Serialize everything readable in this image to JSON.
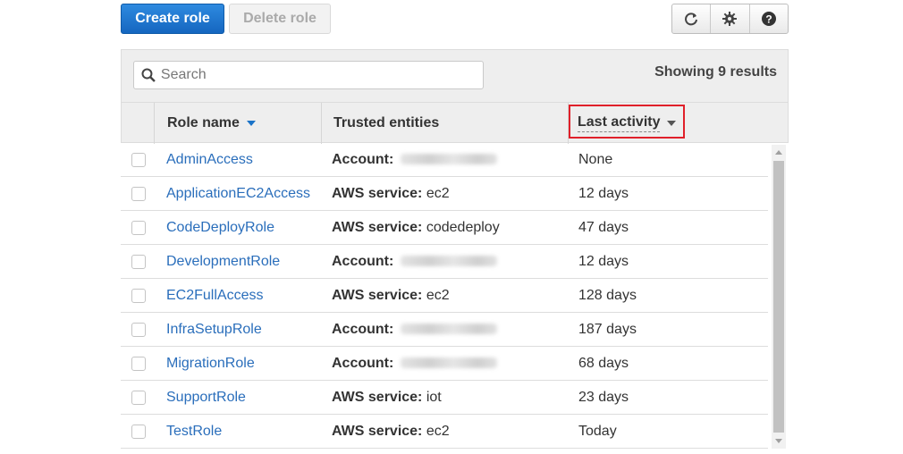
{
  "toolbar": {
    "create_label": "Create role",
    "delete_label": "Delete role",
    "icons": [
      "refresh-icon",
      "gear-icon",
      "help-icon"
    ]
  },
  "search": {
    "placeholder": "Search",
    "value": ""
  },
  "results": {
    "summary": "Showing 9 results"
  },
  "table": {
    "columns": {
      "role_name": "Role name",
      "trusted_entities": "Trusted entities",
      "last_activity": "Last activity"
    },
    "rows": [
      {
        "name": "AdminAccess",
        "trusted_type": "Account:",
        "trusted_value": "",
        "activity": "None"
      },
      {
        "name": "ApplicationEC2Access",
        "trusted_type": "AWS service:",
        "trusted_value": "ec2",
        "activity": "12 days"
      },
      {
        "name": "CodeDeployRole",
        "trusted_type": "AWS service:",
        "trusted_value": "codedeploy",
        "activity": "47 days"
      },
      {
        "name": "DevelopmentRole",
        "trusted_type": "Account:",
        "trusted_value": "",
        "activity": "12 days"
      },
      {
        "name": "EC2FullAccess",
        "trusted_type": "AWS service:",
        "trusted_value": "ec2",
        "activity": "128 days"
      },
      {
        "name": "InfraSetupRole",
        "trusted_type": "Account:",
        "trusted_value": "",
        "activity": "187 days"
      },
      {
        "name": "MigrationRole",
        "trusted_type": "Account:",
        "trusted_value": "",
        "activity": "68 days"
      },
      {
        "name": "SupportRole",
        "trusted_type": "AWS service:",
        "trusted_value": "iot",
        "activity": "23 days"
      },
      {
        "name": "TestRole",
        "trusted_type": "AWS service:",
        "trusted_value": "ec2",
        "activity": "Today"
      }
    ]
  },
  "colors": {
    "primary": "#1a73c8",
    "link": "#2a6ebb",
    "highlight": "#e0202a"
  }
}
